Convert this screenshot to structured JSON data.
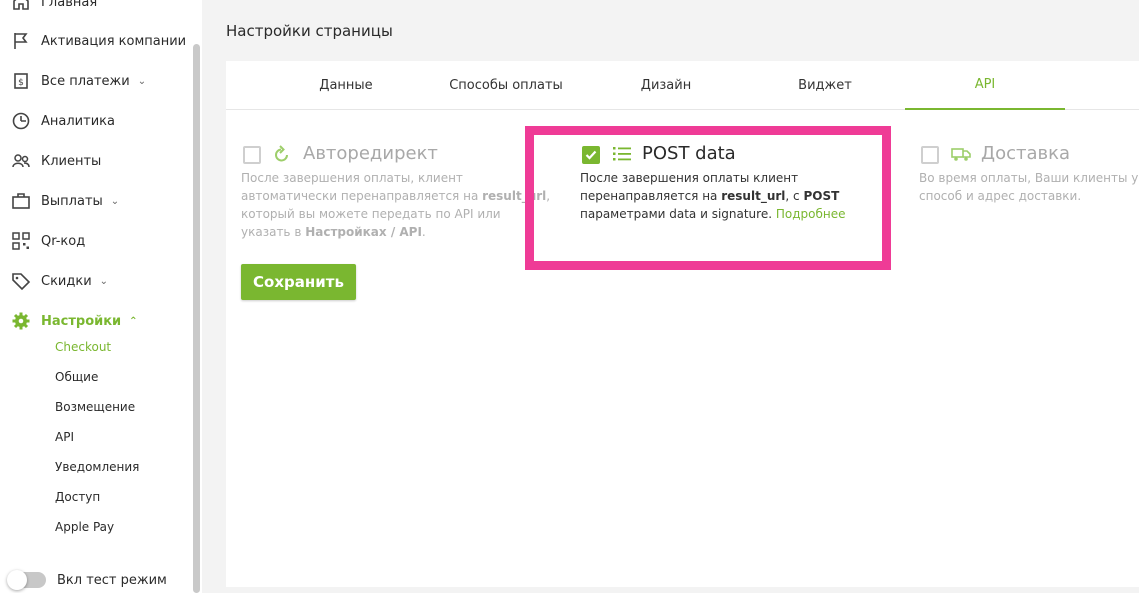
{
  "sidebar": {
    "items": [
      {
        "label": "Главная",
        "icon": "home-icon"
      },
      {
        "label": "Активация компании",
        "icon": "flag-icon"
      },
      {
        "label": "Все платежи",
        "icon": "receipt-icon",
        "chevron": "⌄"
      },
      {
        "label": "Аналитика",
        "icon": "clock-icon"
      },
      {
        "label": "Клиенты",
        "icon": "users-icon"
      },
      {
        "label": "Выплаты",
        "icon": "briefcase-icon",
        "chevron": "⌄"
      },
      {
        "label": "Qr-код",
        "icon": "qr-code-icon"
      },
      {
        "label": "Скидки",
        "icon": "tag-icon",
        "chevron": "⌄"
      },
      {
        "label": "Настройки",
        "icon": "gear-icon",
        "chevron": "⌃"
      }
    ],
    "subitems": [
      "Checkout",
      "Общие",
      "Возмещение",
      "API",
      "Уведомления",
      "Доступ",
      "Apple Pay"
    ],
    "test_mode_label": "Вкл тест режим"
  },
  "page": {
    "title": "Настройки страницы"
  },
  "tabs": [
    "Данные",
    "Способы оплаты",
    "Дизайн",
    "Виджет",
    "API"
  ],
  "active_tab": "API",
  "options": {
    "autoredirect": {
      "title": "Авторедирект",
      "desc_1": "После завершения оплаты, клиент автоматически перенаправляется на ",
      "desc_bold_1": "result_url",
      "desc_2": ", который вы можете передать по API или указать в ",
      "desc_bold_2": "Настройках / API",
      "desc_3": ".",
      "checked": false
    },
    "post_data": {
      "title": "POST data",
      "desc_1": "После завершения оплаты клиент перенаправляется на ",
      "desc_bold_1": "result_url",
      "desc_2": ", с ",
      "desc_bold_2": "POST",
      "desc_3": " параметрами data и signature. ",
      "link": "Подробнее",
      "checked": true
    },
    "delivery": {
      "title": "Доставка",
      "desc": "Во время оплаты, Ваши клиенты у способ и адрес доставки.",
      "checked": false
    }
  },
  "save_label": "Сохранить",
  "colors": {
    "accent": "#7ab730",
    "highlight": "#ef3b96"
  }
}
